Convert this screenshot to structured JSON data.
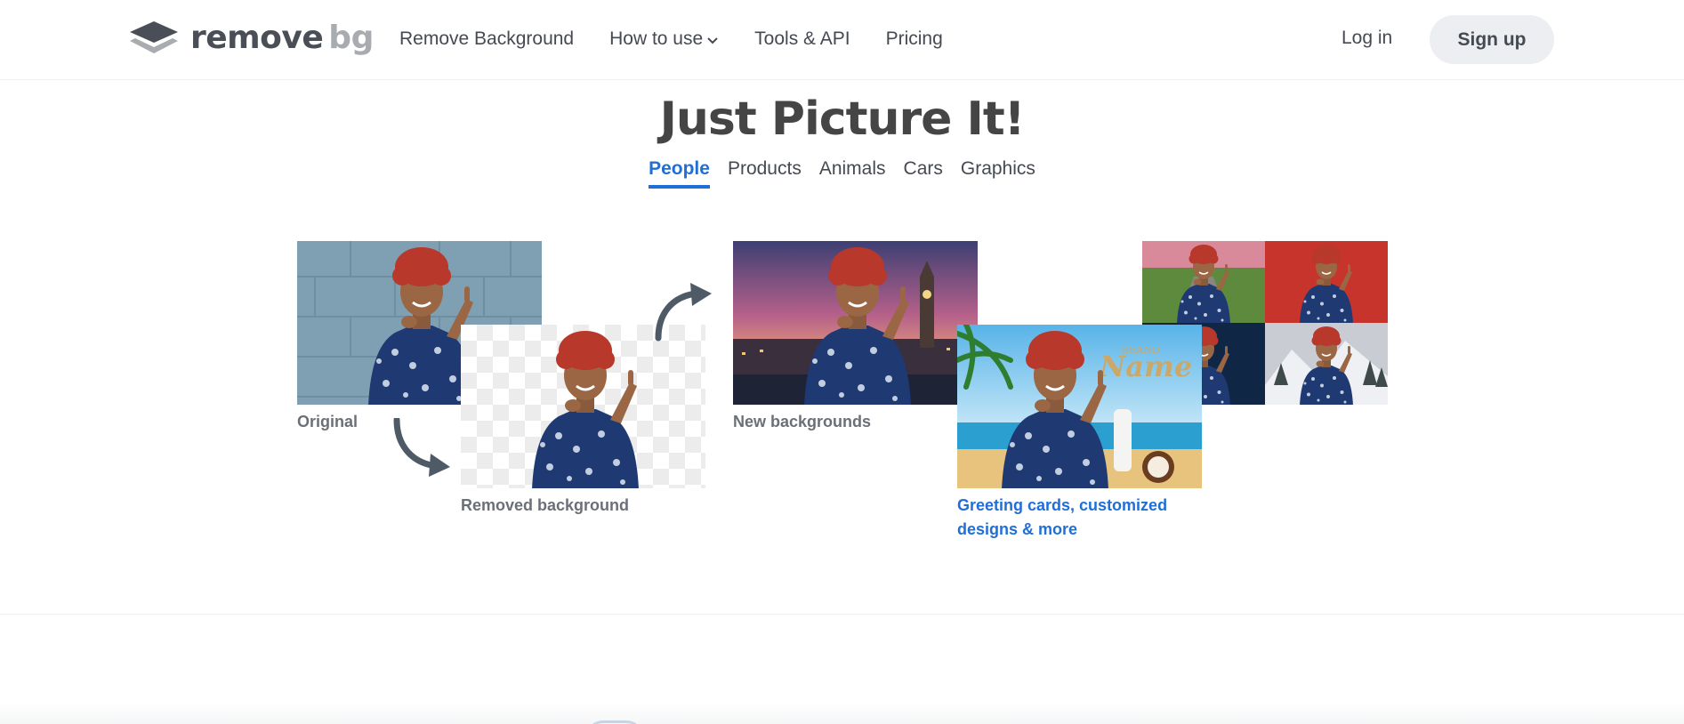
{
  "header": {
    "logo": {
      "word1": "remove",
      "word2": "bg"
    },
    "nav": [
      {
        "label": "Remove Background"
      },
      {
        "label": "How to use",
        "has_dropdown": true
      },
      {
        "label": "Tools & API"
      },
      {
        "label": "Pricing"
      }
    ],
    "login_label": "Log in",
    "signup_label": "Sign up"
  },
  "hero": {
    "title": "Just Picture It!",
    "tabs": [
      {
        "label": "People",
        "active": true
      },
      {
        "label": "Products",
        "active": false
      },
      {
        "label": "Animals",
        "active": false
      },
      {
        "label": "Cars",
        "active": false
      },
      {
        "label": "Graphics",
        "active": false
      }
    ]
  },
  "showcase": {
    "original_caption": "Original",
    "removed_caption": "Removed background",
    "new_bg_caption": "New backgrounds",
    "greeting_caption_line1": "Greeting cards, customized",
    "greeting_caption_line2": "designs & more",
    "brand_text": "BRAND",
    "brand_name": "Name"
  },
  "colors": {
    "accent": "#1f6fd6",
    "text": "#454545",
    "signup_bg": "#eceef1",
    "hair": "#b8382c",
    "dress": "#1f3a73"
  }
}
